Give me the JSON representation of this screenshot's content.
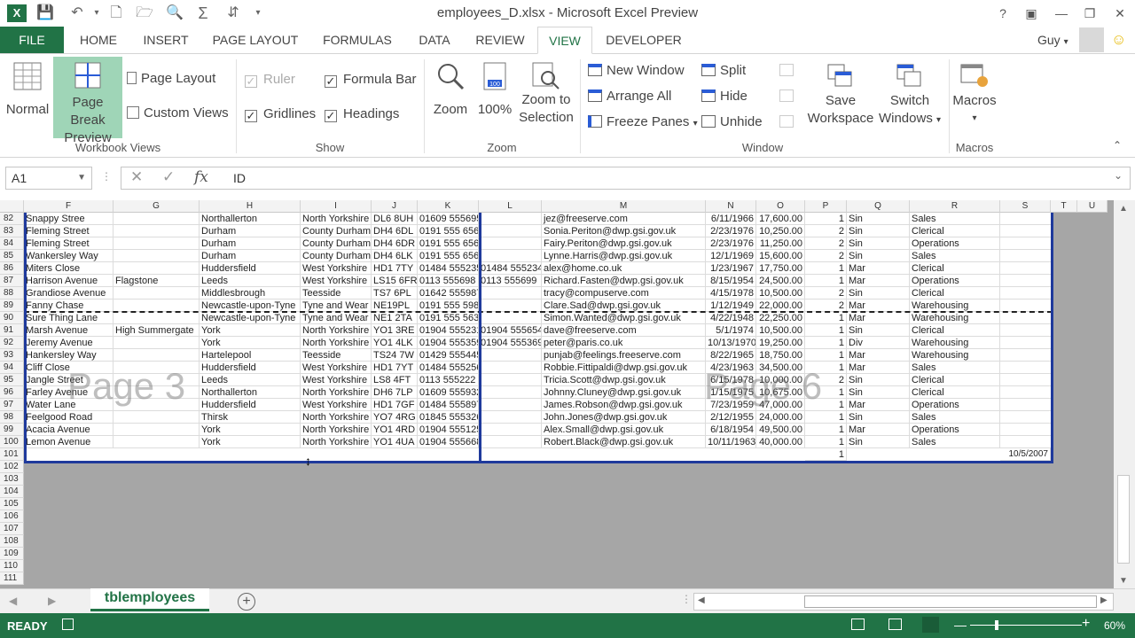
{
  "app": {
    "title": "employees_D.xlsx - Microsoft Excel Preview",
    "logo": "X"
  },
  "tabs": [
    "FILE",
    "HOME",
    "INSERT",
    "PAGE LAYOUT",
    "FORMULAS",
    "DATA",
    "REVIEW",
    "VIEW",
    "DEVELOPER"
  ],
  "active_tab": "VIEW",
  "user": {
    "name": "Guy"
  },
  "ribbon": {
    "workbook_views": {
      "label": "Workbook Views",
      "normal": "Normal",
      "page_break_preview": [
        "Page Break",
        "Preview"
      ],
      "page_layout": "Page Layout",
      "custom_views": "Custom Views"
    },
    "show": {
      "label": "Show",
      "ruler": "Ruler",
      "gridlines": "Gridlines",
      "formula_bar": "Formula Bar",
      "headings": "Headings"
    },
    "zoom": {
      "label": "Zoom",
      "zoom": "Zoom",
      "hundred": "100%",
      "zoom_to_selection": [
        "Zoom to",
        "Selection"
      ],
      "icon_hundred": "100"
    },
    "window": {
      "label": "Window",
      "new_window": "New Window",
      "arrange_all": "Arrange All",
      "freeze_panes": "Freeze Panes",
      "split": "Split",
      "hide": "Hide",
      "unhide": "Unhide",
      "save_workspace": [
        "Save",
        "Workspace"
      ],
      "switch_windows": [
        "Switch",
        "Windows"
      ]
    },
    "macros": {
      "label": "Macros",
      "macros": "Macros"
    }
  },
  "formula_bar": {
    "name_box": "A1",
    "value": "ID",
    "fx": "fx"
  },
  "columns": [
    "F",
    "G",
    "H",
    "I",
    "J",
    "K",
    "L",
    "M",
    "N",
    "O",
    "P",
    "Q",
    "R",
    "S",
    "T",
    "U"
  ],
  "row_numbers": [
    "82",
    "83",
    "84",
    "85",
    "86",
    "87",
    "88",
    "89",
    "90",
    "91",
    "92",
    "93",
    "94",
    "95",
    "96",
    "97",
    "98",
    "99",
    "100",
    "101",
    "102",
    "103",
    "104",
    "105",
    "106",
    "107",
    "108",
    "109",
    "110",
    "111"
  ],
  "rows": [
    [
      "Snappy Stree",
      "",
      "Northallerton",
      "North Yorkshire",
      "DL6 8UH",
      "01609 555695",
      "",
      "jez@freeserve.com",
      "6/11/1966",
      "17,600.00",
      "1",
      "Sin",
      "Sales"
    ],
    [
      "Fleming Street",
      "",
      "Durham",
      "County Durham",
      "DH4 6DL",
      "0191 555 6569",
      "",
      "Sonia.Periton@dwp.gsi.gov.uk",
      "2/23/1976",
      "10,250.00",
      "2",
      "Sin",
      "Clerical"
    ],
    [
      "Fleming Street",
      "",
      "Durham",
      "County Durham",
      "DH4 6DR",
      "0191 555 6569",
      "",
      "Fairy.Periton@dwp.gsi.gov.uk",
      "2/23/1976",
      "11,250.00",
      "2",
      "Sin",
      "Operations"
    ],
    [
      "Wankersley Way",
      "",
      "Durham",
      "County Durham",
      "DH4 6LK",
      "0191 555 6562",
      "",
      "Lynne.Harris@dwp.gsi.gov.uk",
      "12/1/1969",
      "15,600.00",
      "2",
      "Sin",
      "Sales"
    ],
    [
      "Miters Close",
      "",
      "Huddersfield",
      "West Yorkshire",
      "HD1 7TY",
      "01484 555235",
      "01484 555234",
      "alex@home.co.uk",
      "1/23/1967",
      "17,750.00",
      "1",
      "Mar",
      "Clerical"
    ],
    [
      "Harrison Avenue",
      "Flagstone",
      "Leeds",
      "West Yorkshire",
      "LS15 6FR",
      "0113 555698",
      "0113 555699",
      "Richard.Fasten@dwp.gsi.gov.uk",
      "8/15/1954",
      "24,500.00",
      "1",
      "Mar",
      "Operations"
    ],
    [
      "Grandiose Avenue",
      "",
      "Middlesbrough",
      "Teesside",
      "TS7 6PL",
      "01642 555987",
      "",
      "tracy@compuserve.com",
      "4/15/1978",
      "10,500.00",
      "2",
      "Sin",
      "Clerical"
    ],
    [
      "Fanny Chase",
      "",
      "Newcastle-upon-Tyne",
      "Tyne and Wear",
      "NE19PL",
      "0191 555 5987",
      "",
      "Clare.Sad@dwp.gsi.gov.uk",
      "1/12/1949",
      "22,000.00",
      "2",
      "Mar",
      "Warehousing"
    ],
    [
      "Sure Thing Lane",
      "",
      "Newcastle-upon-Tyne",
      "Tyne and Wear",
      "NE1 2TA",
      "0191 555 5632",
      "",
      "Simon.Wanted@dwp.gsi.gov.uk",
      "4/22/1948",
      "22,250.00",
      "1",
      "Mar",
      "Warehousing"
    ],
    [
      "Marsh Avenue",
      "High Summergate",
      "York",
      "North Yorkshire",
      "YO1 3RE",
      "01904 555231",
      "01904 555654",
      "dave@freeserve.com",
      "5/1/1974",
      "10,500.00",
      "1",
      "Sin",
      "Clerical"
    ],
    [
      "Jeremy Avenue",
      "",
      "York",
      "North Yorkshire",
      "YO1 4LK",
      "01904 555359",
      "01904 555369",
      "peter@paris.co.uk",
      "10/13/1970",
      "19,250.00",
      "1",
      "Div",
      "Warehousing"
    ],
    [
      "Hankersley Way",
      "",
      "Hartelepool",
      "Teesside",
      "TS24 7W",
      "01429 555445",
      "",
      "punjab@feelings.freeserve.com",
      "8/22/1965",
      "18,750.00",
      "1",
      "Mar",
      "Warehousing"
    ],
    [
      "Cliff Close",
      "",
      "Huddersfield",
      "West Yorkshire",
      "HD1 7YT",
      "01484 555256",
      "",
      "Robbie.Fittipaldi@dwp.gsi.gov.uk",
      "4/23/1963",
      "34,500.00",
      "1",
      "Mar",
      "Sales"
    ],
    [
      "Jangle Street",
      "",
      "Leeds",
      "West Yorkshire",
      "LS8 4FT",
      "0113 555222",
      "",
      "Tricia.Scott@dwp.gsi.gov.uk",
      "6/15/1978",
      "10,000.00",
      "2",
      "Sin",
      "Clerical"
    ],
    [
      "Farley Avenue",
      "",
      "Northallerton",
      "North Yorkshire",
      "DH6 7LP",
      "01609 555932",
      "",
      "Johnny.Cluney@dwp.gsi.gov.uk",
      "1/15/1975",
      "10,675.00",
      "1",
      "Sin",
      "Clerical"
    ],
    [
      "Water Lane",
      "",
      "Huddersfield",
      "West Yorkshire",
      "HD1 7GF",
      "01484 555897",
      "",
      "James.Robson@dwp.gsi.gov.uk",
      "7/23/1959",
      "47,000.00",
      "1",
      "Mar",
      "Operations"
    ],
    [
      "Feelgood Road",
      "",
      "Thirsk",
      "North Yorkshire",
      "YO7 4RG",
      "01845 555326",
      "",
      "John.Jones@dwp.gsi.gov.uk",
      "2/12/1955",
      "24,000.00",
      "1",
      "Sin",
      "Sales"
    ],
    [
      "Acacia Avenue",
      "",
      "York",
      "North Yorkshire",
      "YO1 4RD",
      "01904 555125",
      "",
      "Alex.Small@dwp.gsi.gov.uk",
      "6/18/1954",
      "49,500.00",
      "1",
      "Mar",
      "Operations"
    ],
    [
      "Lemon Avenue",
      "",
      "York",
      "North Yorkshire",
      "YO1 4UA",
      "01904 555668",
      "",
      "Robert.Black@dwp.gsi.gov.uk",
      "10/11/1963",
      "40,000.00",
      "1",
      "Sin",
      "Sales"
    ]
  ],
  "row_101": {
    "p": "1",
    "s": "10/5/2007"
  },
  "watermarks": [
    "Page 3",
    "Page 6"
  ],
  "sheet_tabs": [
    "tblemployees"
  ],
  "status": {
    "ready": "READY",
    "zoom": "60%"
  },
  "colors": {
    "accent": "#217346",
    "pressed": "#9fd5b7",
    "page_break": "#1f3a9c"
  }
}
